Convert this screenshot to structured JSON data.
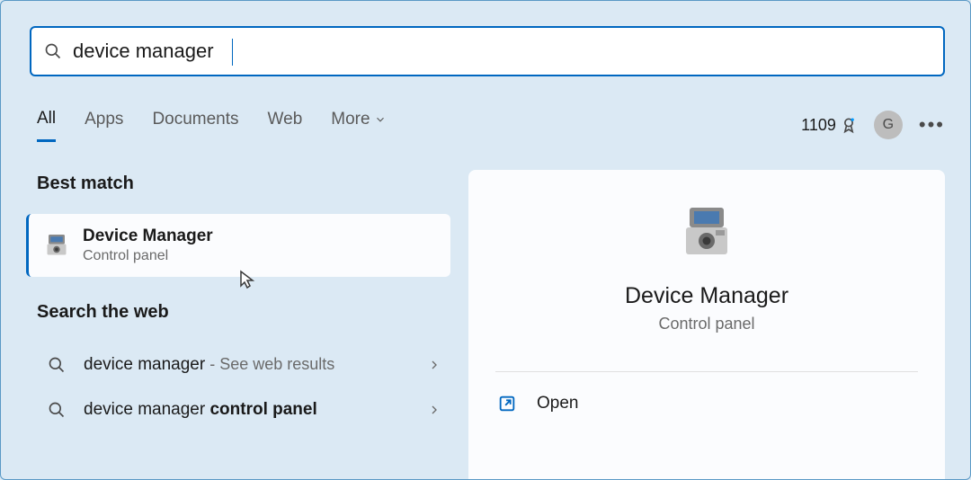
{
  "search": {
    "query": "device manager"
  },
  "tabs": {
    "all": "All",
    "apps": "Apps",
    "documents": "Documents",
    "web": "Web",
    "more": "More"
  },
  "header": {
    "points": "1109",
    "avatar_initial": "G"
  },
  "left": {
    "best_match_label": "Best match",
    "best_match": {
      "title": "Device Manager",
      "subtitle": "Control panel"
    },
    "search_web_label": "Search the web",
    "web_results": [
      {
        "text": "device manager",
        "suffix": " - See web results"
      },
      {
        "text_prefix": "device manager ",
        "text_bold": "control panel"
      }
    ]
  },
  "right": {
    "title": "Device Manager",
    "subtitle": "Control panel",
    "open_label": "Open"
  }
}
